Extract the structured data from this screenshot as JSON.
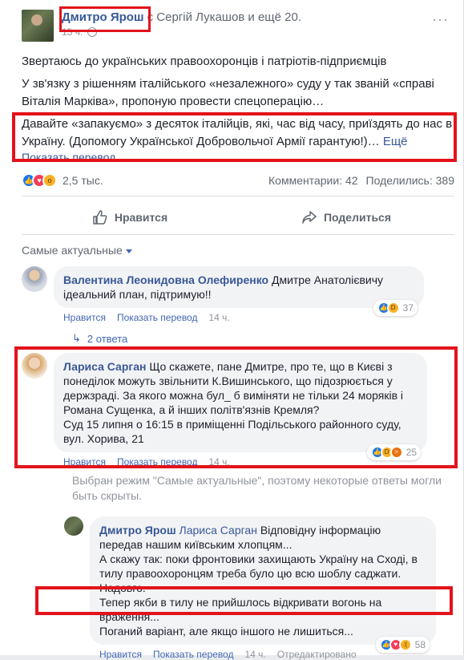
{
  "post": {
    "author": "Дмитро Ярош",
    "with_text": "с Сергій Лукашов и ещё 20.",
    "time": "15 ч.",
    "paragraph1": "Звертаюсь до українських правоохоронців і патріотів-підприємців",
    "paragraph2": "У зв'язку з рішенням італійського «незалежного» суду у так званій «справі Віталія Марківа», пропоную провести спецоперацію…",
    "paragraph3": "Давайте «запакуємо» з десяток італійців, які, час від часу, приїздять до нас в Україну. (Допомогу Української Добровольчої Армії гарантую!)…",
    "see_more": "Ещё",
    "translate": "Показать перевод",
    "reactions_count": "2,5 тыс.",
    "comments": "Комментарии: 42",
    "shares": "Поделились: 389",
    "like_button": "Нравится",
    "share_button": "Поделиться"
  },
  "filter": {
    "label": "Самые актуальные"
  },
  "comments": [
    {
      "name": "Валентина Леонидовна Олефиренко",
      "text": "Дмитре Анатолієвичу ідеальний план, підтримую!!",
      "like": "Нравится",
      "translate": "Показать перевод",
      "time": "14 ч.",
      "reactions": "37"
    },
    {
      "replies": "2 ответа"
    },
    {
      "name": "Лариса Сарган",
      "text": "Що скажете, пане Дмитре, про те, що в Києві з понеділок можуть звільнити К.Вишинського, що підозрюється у держзраді. За якого можна бул_ б виміняти не тільки 24 моряків і Романа Сущенка, а й інших політв'язнів Кремля?",
      "text2": "Суд 15 липня о 16:15 в приміщенні Подільського районного суду, вул. Хорива, 21",
      "like": "Нравится",
      "translate": "Показать перевод",
      "time": "14 ч.",
      "reactions": "25"
    },
    {
      "note": "Выбран режим \"Самые актуальные\", поэтому некоторые ответы могли быть скрыты."
    },
    {
      "name": "Дмитро Ярош",
      "mention": "Лариса Сарган",
      "text": "Відповідну інформацію передав нашим київським хлопцям...",
      "text2": "А скажу так: поки фронтовики захищають Україну на Сході, в тилу правоохоронцям треба було цю всю шоблу саджати.",
      "text3": "Надовго.",
      "text4": "Тепер якби в тилу не прийшлось відкривати вогонь на враження...",
      "text5": "Поганий варіант, але якщо іншого не лишиться...",
      "like": "Нравится",
      "translate": "Показать перевод",
      "time": "14 ч.",
      "edited": "Отредактировано",
      "reactions": "58"
    }
  ],
  "colors": {
    "link": "#385898",
    "highlight": "#e3131b"
  }
}
